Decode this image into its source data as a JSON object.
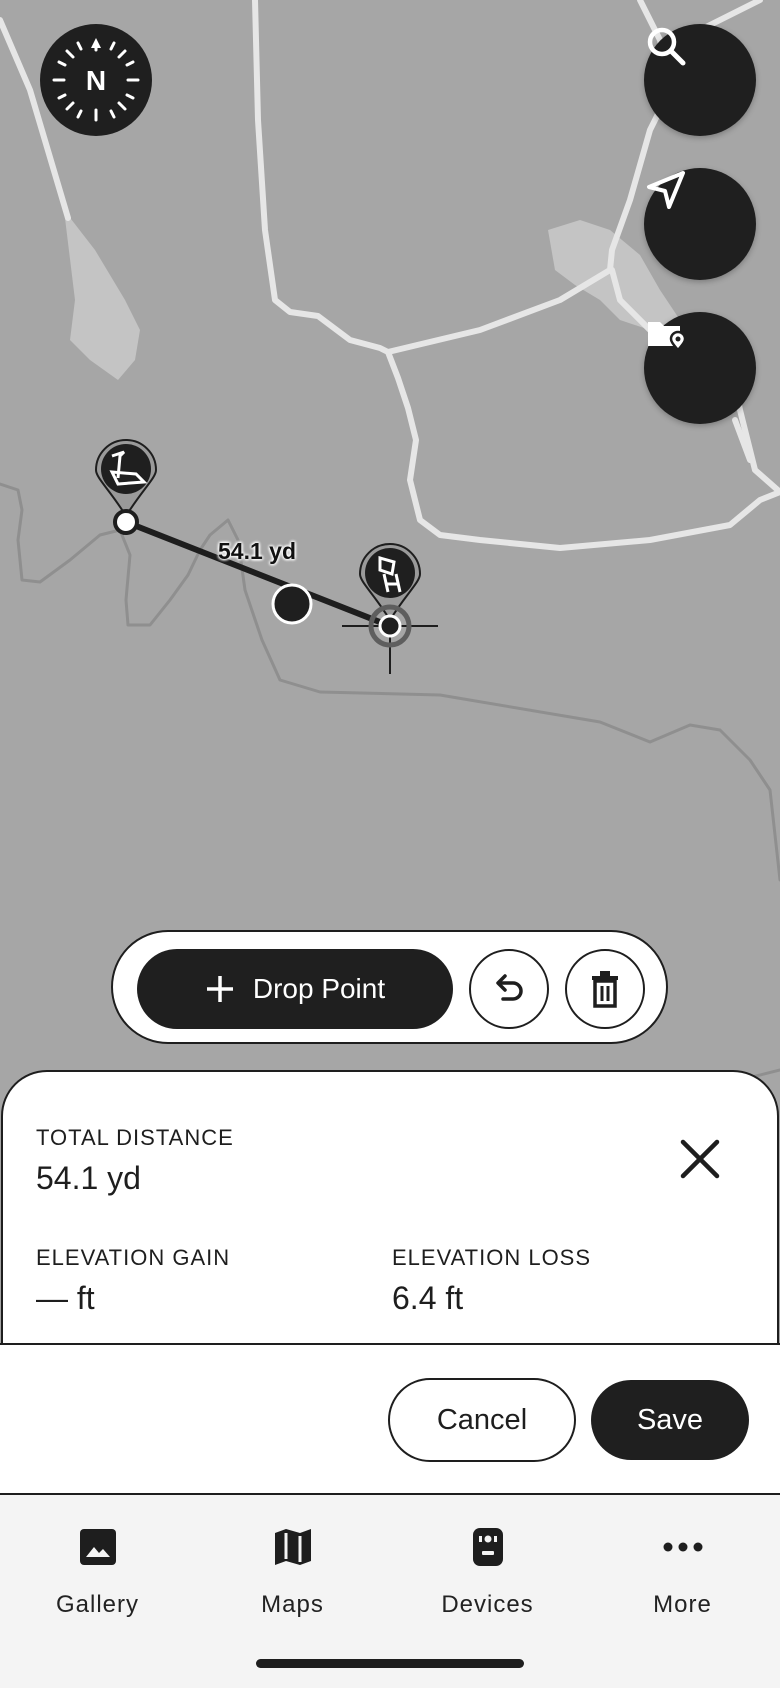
{
  "map": {
    "compass_letter": "N",
    "distance_label": "54.1 yd"
  },
  "toolbar": {
    "drop_point_label": "Drop Point"
  },
  "stats": {
    "total_distance_label": "TOTAL DISTANCE",
    "total_distance_value": "54.1 yd",
    "elevation_gain_label": "ELEVATION GAIN",
    "elevation_gain_value": "— ft",
    "elevation_loss_label": "ELEVATION LOSS",
    "elevation_loss_value": "6.4 ft"
  },
  "actions": {
    "cancel_label": "Cancel",
    "save_label": "Save"
  },
  "nav": {
    "items": [
      {
        "label": "Gallery",
        "icon": "gallery-icon"
      },
      {
        "label": "Maps",
        "icon": "map-icon"
      },
      {
        "label": "Devices",
        "icon": "device-icon"
      },
      {
        "label": "More",
        "icon": "more-icon"
      }
    ]
  },
  "colors": {
    "map_background": "#a6a6a6",
    "dark": "#1f1f1f",
    "road": "#e6e6e6",
    "water": "#c4c4c4"
  }
}
